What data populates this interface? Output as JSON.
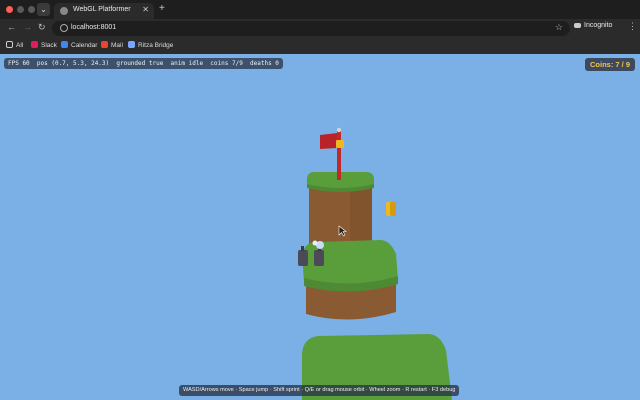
{
  "browser": {
    "tab_title": "WebGL Platformer",
    "url": "localhost:8001",
    "profile_label": "Incognito",
    "bookmarks": [
      "All",
      "Slack",
      "Calendar",
      "Mail",
      "Ritza Bridge"
    ]
  },
  "hud": {
    "debug_line": "FPS 60  pos (0.7, 5.3, 24.3)  grounded true  anim idle  coins 7/9  deaths 0",
    "coins_label": "Coins: 7 / 9",
    "help_text": "WASD/Arrows move · Space jump · Shift sprint · Q/E or drag mouse orbit · Wheel zoom · R restart · F3 debug"
  },
  "colors": {
    "sky": "#7ab0e6",
    "grass": "#5a9e3c",
    "dirt": "#8a5a32",
    "flag": "#c0282a",
    "coin": "#f0b820"
  },
  "icons": {
    "back": "arrow-left-icon",
    "forward": "arrow-right-icon",
    "reload": "reload-icon",
    "bookmark": "star-icon",
    "menu": "kebab-menu-icon"
  }
}
